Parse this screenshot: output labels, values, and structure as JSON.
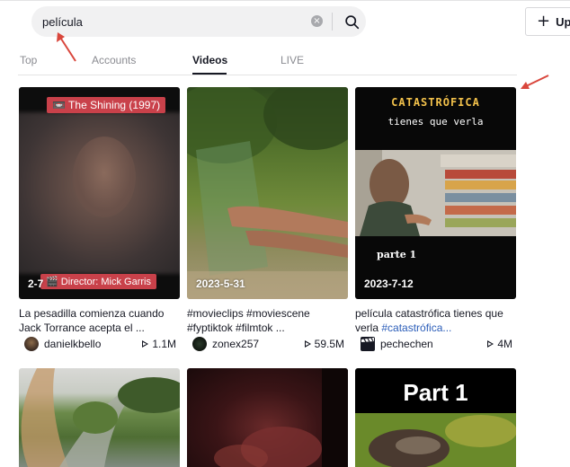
{
  "search": {
    "value": "película"
  },
  "header": {
    "upload_label": "Upl"
  },
  "tabs": [
    {
      "label": "Top"
    },
    {
      "label": "Accounts"
    },
    {
      "label": "Videos"
    },
    {
      "label": "LIVE"
    }
  ],
  "active_tab": "Videos",
  "videos": [
    {
      "overlay_title": "📼 The Shining (1997)",
      "overlay_director": "🎬 Director: Mick Garris",
      "date": "2-7",
      "description": "La pesadilla comienza cuando Jack Torrance acepta el ...",
      "author": "danielkbello",
      "views": "1.1M"
    },
    {
      "date": "2023-5-31",
      "tags": "#movieclips #moviescene #fyptiktok #filmtok ...",
      "author": "zonex257",
      "views": "59.5M"
    },
    {
      "overlay_title": "CATASTRÓFICA",
      "overlay_subtitle": "tienes que verla",
      "overlay_part": "parte 1",
      "date": "2023-7-12",
      "description": "película catastrófica tienes que verla",
      "description_tag": "#catastrófica...",
      "author": "pechechen",
      "views": "4M"
    },
    {
      "overlay_title": "Part 1"
    }
  ],
  "colors": {
    "accent_red": "#c9414a",
    "tag_blue": "#2b5db9",
    "annotation_arrow": "#d9463c",
    "catastrofica_yellow": "#f2c14b"
  },
  "icons": [
    "search-icon",
    "clear-icon",
    "plus-icon",
    "play-icon"
  ]
}
